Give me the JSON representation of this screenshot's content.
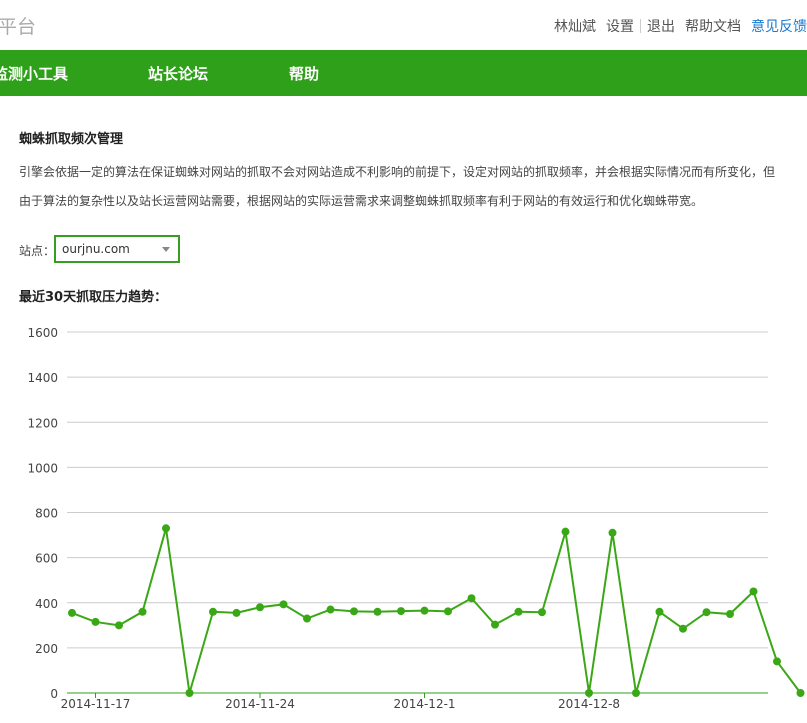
{
  "header": {
    "brand": "平台",
    "links": [
      "林灿斌",
      "设置",
      "退出",
      "帮助文档"
    ],
    "feedback": "意见反馈"
  },
  "nav": {
    "items": [
      "监测小工具",
      "站长论坛",
      "帮助"
    ]
  },
  "main": {
    "title": "蜘蛛抓取频次管理",
    "desc1": "引擎会依据一定的算法在保证蜘蛛对网站的抓取不会对网站造成不利影响的前提下，设定对网站的抓取频率，并会根据实际情况而有所变化，但",
    "desc2": "由于算法的复杂性以及站长运营网站需要，根据网站的实际运营需求来调整蜘蛛抓取频率有利于网站的有效运行和优化蜘蛛带宽。",
    "site_label": "站点：",
    "site_value": "ourjnu.com",
    "chart_title": "最近30天抓取压力趋势："
  },
  "colors": {
    "accent": "#2ea019",
    "line": "#3aa816",
    "grid": "#cccccc",
    "link": "#1a7ad0"
  },
  "chart_data": {
    "type": "line",
    "x": [
      "2014-11-16",
      "2014-11-17",
      "2014-11-18",
      "2014-11-19",
      "2014-11-20",
      "2014-11-21",
      "2014-11-22",
      "2014-11-23",
      "2014-11-24",
      "2014-11-25",
      "2014-11-26",
      "2014-11-27",
      "2014-11-28",
      "2014-11-29",
      "2014-11-30",
      "2014-12-01",
      "2014-12-02",
      "2014-12-03",
      "2014-12-04",
      "2014-12-05",
      "2014-12-06",
      "2014-12-07",
      "2014-12-08",
      "2014-12-09",
      "2014-12-10",
      "2014-12-11",
      "2014-12-12",
      "2014-12-13",
      "2014-12-14",
      "2014-12-15",
      "2014-12-16",
      "2014-12-17"
    ],
    "values": [
      355,
      315,
      300,
      360,
      730,
      0,
      360,
      355,
      380,
      393,
      330,
      370,
      362,
      360,
      363,
      365,
      362,
      420,
      303,
      360,
      358,
      715,
      0,
      710,
      0,
      360,
      285,
      358,
      350,
      450,
      140,
      0
    ],
    "xtick_labels": [
      "2014-11-17",
      "2014-11-24",
      "2014-12-1",
      "2014-12-8"
    ],
    "xtick_dates": [
      "2014-11-17",
      "2014-11-24",
      "2014-12-01",
      "2014-12-08"
    ],
    "yticks": [
      0,
      200,
      400,
      600,
      800,
      1000,
      1200,
      1400,
      1600
    ],
    "ylim": [
      0,
      1600
    ],
    "grid": true,
    "title": "",
    "xlabel": "",
    "ylabel": ""
  }
}
